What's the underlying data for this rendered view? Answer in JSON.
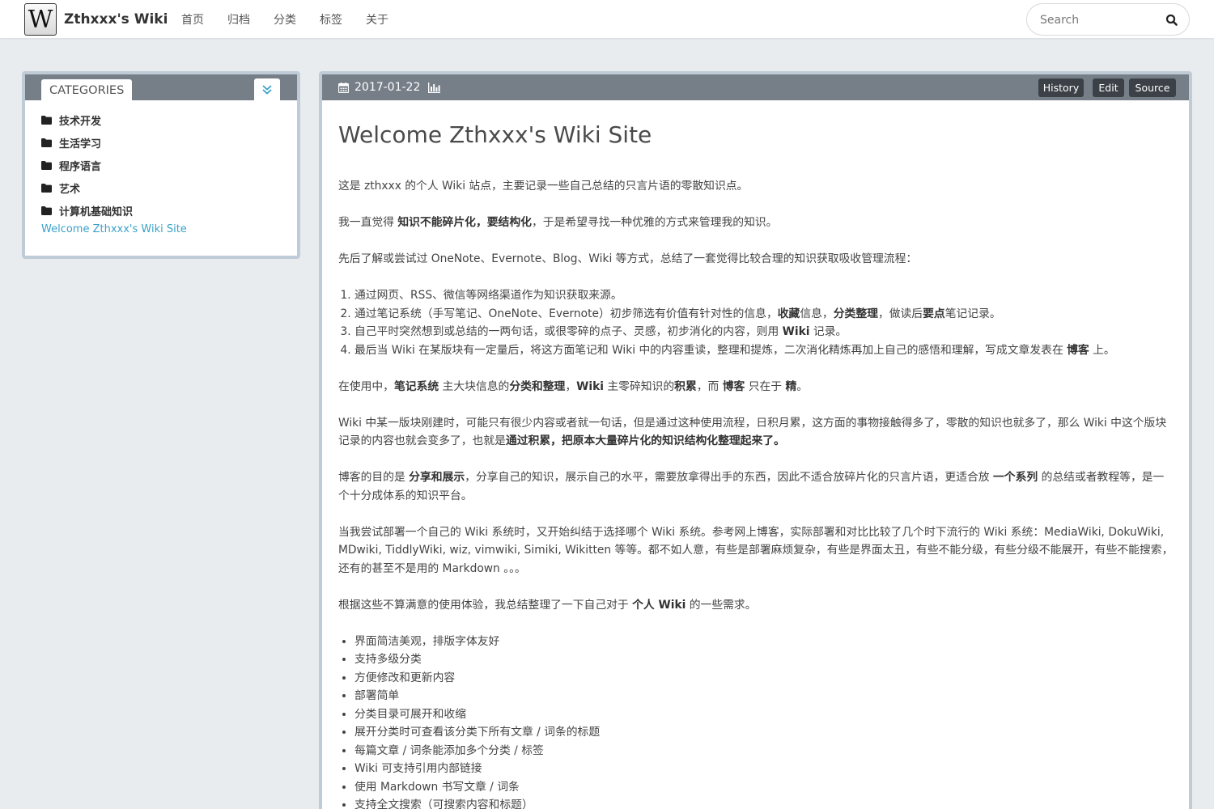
{
  "nav": {
    "brand_logo": "W",
    "brand": "Zthxxx's Wiki",
    "items": [
      "首页",
      "归档",
      "分类",
      "标签",
      "关于"
    ],
    "search_placeholder": "Search"
  },
  "sidebar": {
    "header": "CATEGORIES",
    "categories": [
      "技术开发",
      "生活学习",
      "程序语言",
      "艺术",
      "计算机基础知识"
    ],
    "link": "Welcome Zthxxx's Wiki Site"
  },
  "article": {
    "date": "2017-01-22",
    "buttons": [
      "History",
      "Edit",
      "Source"
    ],
    "title": "Welcome Zthxxx's Wiki Site",
    "p1": "这是 zthxxx 的个人 Wiki 站点，主要记录一些自己总结的只言片语的零散知识点。",
    "p2": [
      {
        "t": "我一直觉得 "
      },
      {
        "t": "知识不能碎片化，要结构化",
        "b": true
      },
      {
        "t": "，于是希望寻找一种优雅的方式来管理我的知识。"
      }
    ],
    "p3": "先后了解或尝试过 OneNote、Evernote、Blog、Wiki 等方式，总结了一套觉得比较合理的知识获取吸收管理流程：",
    "ol": [
      [
        {
          "t": "通过网页、RSS、微信等网络渠道作为知识获取来源。"
        }
      ],
      [
        {
          "t": "通过笔记系统（手写笔记、OneNote、Evernote）初步筛选有价值有针对性的信息，"
        },
        {
          "t": "收藏",
          "b": true
        },
        {
          "t": "信息，"
        },
        {
          "t": "分类整理",
          "b": true
        },
        {
          "t": "，做读后"
        },
        {
          "t": "要点",
          "b": true
        },
        {
          "t": "笔记记录。"
        }
      ],
      [
        {
          "t": "自己平时突然想到或总结的一两句话，或很零碎的点子、灵感，初步消化的内容，则用 "
        },
        {
          "t": "Wiki",
          "b": true
        },
        {
          "t": " 记录。"
        }
      ],
      [
        {
          "t": "最后当 Wiki 在某版块有一定量后，将这方面笔记和 Wiki 中的内容重读，整理和提炼，二次消化精炼再加上自己的感悟和理解，写成文章发表在 "
        },
        {
          "t": "博客",
          "b": true
        },
        {
          "t": " 上。"
        }
      ]
    ],
    "p4": [
      {
        "t": "在使用中，"
      },
      {
        "t": "笔记系统",
        "b": true
      },
      {
        "t": " 主大块信息的"
      },
      {
        "t": "分类和整理",
        "b": true
      },
      {
        "t": "，"
      },
      {
        "t": "Wiki",
        "b": true
      },
      {
        "t": " 主零碎知识的"
      },
      {
        "t": "积累",
        "b": true
      },
      {
        "t": "，而 "
      },
      {
        "t": "博客",
        "b": true
      },
      {
        "t": " 只在于 "
      },
      {
        "t": "精",
        "b": true
      },
      {
        "t": "。"
      }
    ],
    "p5": [
      {
        "t": "Wiki 中某一版块刚建时，可能只有很少内容或者就一句话，但是通过这种使用流程，日积月累，这方面的事物接触得多了，零散的知识也就多了，那么 Wiki 中这个版块记录的内容也就会变多了，也就是"
      },
      {
        "t": "通过积累，把原本大量碎片化的知识结构化整理起来了。",
        "b": true
      }
    ],
    "p6": [
      {
        "t": "博客的目的是 "
      },
      {
        "t": "分享和展示",
        "b": true
      },
      {
        "t": "，分享自己的知识，展示自己的水平，需要放拿得出手的东西，因此不适合放碎片化的只言片语，更适合放 "
      },
      {
        "t": "一个系列",
        "b": true
      },
      {
        "t": " 的总结或者教程等，是一个十分成体系的知识平台。"
      }
    ],
    "p7": "当我尝试部署一个自己的 Wiki 系统时，又开始纠结于选择哪个 Wiki 系统。参考网上博客，实际部署和对比比较了几个时下流行的 Wiki 系统：MediaWiki, DokuWiki, MDwiki, TiddlyWiki, wiz, vimwiki, Simiki, Wikitten 等等。都不如人意，有些是部署麻烦复杂，有些是界面太丑，有些不能分级，有些分级不能展开，有些不能搜索，还有的甚至不是用的 Markdown 。。。",
    "p8": [
      {
        "t": "根据这些不算满意的使用体验，我总结整理了一下自己对于 "
      },
      {
        "t": "个人 Wiki",
        "b": true
      },
      {
        "t": " 的一些需求。"
      }
    ],
    "ul": [
      "界面简洁美观，排版字体友好",
      "支持多级分类",
      "方便修改和更新内容",
      "部署简单",
      "分类目录可展开和收缩",
      "展开分类时可查看该分类下所有文章 / 词条的标题",
      "每篇文章 / 词条能添加多个分类 / 标签",
      "Wiki 可支持引用内部链接",
      "使用 Markdown 书写文章 / 词条",
      "支持全文搜索（可搜索内容和标题）"
    ]
  }
}
